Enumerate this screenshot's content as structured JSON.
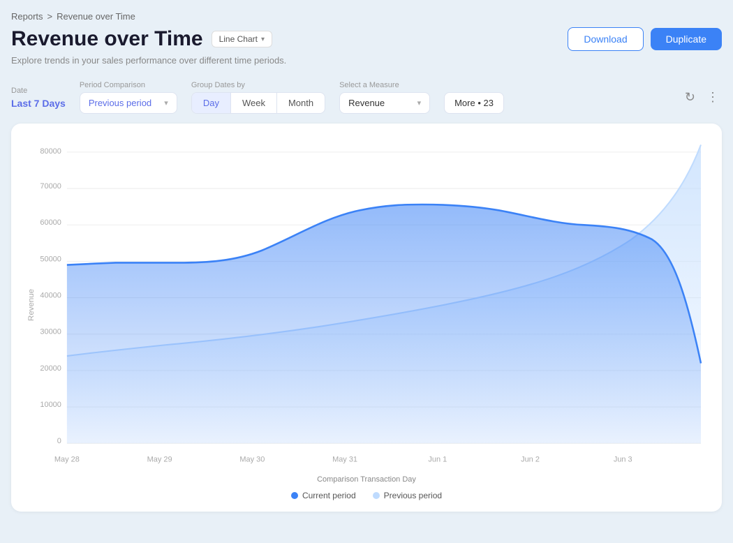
{
  "breadcrumb": {
    "parent": "Reports",
    "separator": ">",
    "current": "Revenue over Time"
  },
  "page": {
    "title": "Revenue over Time",
    "subtitle": "Explore trends in your sales performance over different time periods.",
    "chart_type_label": "Line Chart"
  },
  "actions": {
    "download_label": "Download",
    "duplicate_label": "Duplicate"
  },
  "filters": {
    "date_label": "Date",
    "date_value": "Last 7 Days",
    "period_comparison_label": "Period Comparison",
    "period_comparison_value": "Previous period",
    "group_dates_label": "Group Dates by",
    "group_dates_options": [
      "Day",
      "Week",
      "Month"
    ],
    "group_dates_active": "Day",
    "measure_label": "Select a Measure",
    "measure_value": "Revenue",
    "more_label": "More • 23"
  },
  "chart": {
    "y_axis_label": "Revenue",
    "x_axis_label": "Comparison Transaction Day",
    "y_ticks": [
      "0",
      "10000",
      "20000",
      "30000",
      "40000",
      "50000",
      "60000",
      "70000",
      "80000"
    ],
    "x_ticks": [
      "May 28",
      "May 29",
      "May 30",
      "May 31",
      "Jun 1",
      "Jun 2",
      "Jun 3"
    ],
    "legend": [
      {
        "label": "Current period",
        "color": "#3b82f6"
      },
      {
        "label": "Previous period",
        "color": "#bfdbfe"
      }
    ]
  },
  "icons": {
    "chevron_down": "▾",
    "refresh": "↻",
    "more_vert": "⋮"
  }
}
